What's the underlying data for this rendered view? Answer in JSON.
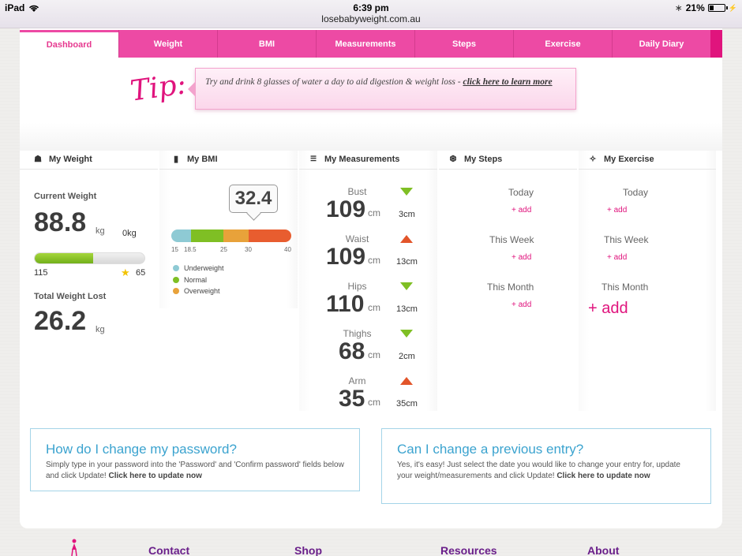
{
  "status_bar": {
    "device": "iPad",
    "time": "6:39 pm",
    "url": "losebabyweight.com.au",
    "battery": "21%"
  },
  "tabs": [
    "Dashboard",
    "Weight",
    "BMI",
    "Measurements",
    "Steps",
    "Exercise",
    "Daily Diary"
  ],
  "tip": {
    "label": "Tip:",
    "text": "Try and drink 8 glasses of water a day to aid digestion & weight loss - ",
    "link": "click here to learn more"
  },
  "weight": {
    "heading": "My Weight",
    "current_label": "Current Weight",
    "current_value": "88.8",
    "unit": "kg",
    "change": "0kg",
    "start": "115",
    "goal": "65",
    "progress_fraction": 0.53,
    "lost_label": "Total Weight Lost",
    "lost_value": "26.2",
    "lost_unit": "kg"
  },
  "bmi": {
    "heading": "My BMI",
    "value": "32.4",
    "ticks": [
      "15",
      "18.5",
      "25",
      "30",
      "40"
    ],
    "legend": [
      "Underweight",
      "Normal",
      "Overweight"
    ],
    "colors": {
      "underweight": "#8ecad4",
      "normal": "#7fbf24",
      "overweight": "#e8a23a",
      "obese": "#e85d2f"
    }
  },
  "measurements": {
    "heading": "My Measurements",
    "items": [
      {
        "label": "Bust",
        "value": "109",
        "unit": "cm",
        "delta": "3cm",
        "direction": "down"
      },
      {
        "label": "Waist",
        "value": "109",
        "unit": "cm",
        "delta": "13cm",
        "direction": "up"
      },
      {
        "label": "Hips",
        "value": "110",
        "unit": "cm",
        "delta": "13cm",
        "direction": "down"
      },
      {
        "label": "Thighs",
        "value": "68",
        "unit": "cm",
        "delta": "2cm",
        "direction": "down"
      },
      {
        "label": "Arm",
        "value": "35",
        "unit": "cm",
        "delta": "35cm",
        "direction": "up"
      }
    ]
  },
  "steps": {
    "heading": "My Steps",
    "rows": [
      {
        "label": "Today",
        "add": "+ add"
      },
      {
        "label": "This Week",
        "add": "+ add"
      },
      {
        "label": "This Month",
        "add": "+ add"
      }
    ]
  },
  "exercise": {
    "heading": "My Exercise",
    "rows": [
      {
        "label": "Today",
        "add": "+ add"
      },
      {
        "label": "This Week",
        "add": "+ add"
      },
      {
        "label": "This Month",
        "add": "+ add"
      }
    ]
  },
  "faq": [
    {
      "title": "How do I change my password?",
      "body": "Simply type in your password into the 'Password' and 'Confirm password' fields below and click Update! ",
      "link": "Click here to update now"
    },
    {
      "title": "Can I change a previous entry?",
      "body": "Yes, it's easy! Just select the date you would like to change your entry for, update your weight/measurements and click Update! ",
      "link": "Click here to update now"
    }
  ],
  "footer_nav": [
    "Contact",
    "Shop",
    "Resources",
    "About"
  ],
  "brand_pink": "#ed4aa4"
}
